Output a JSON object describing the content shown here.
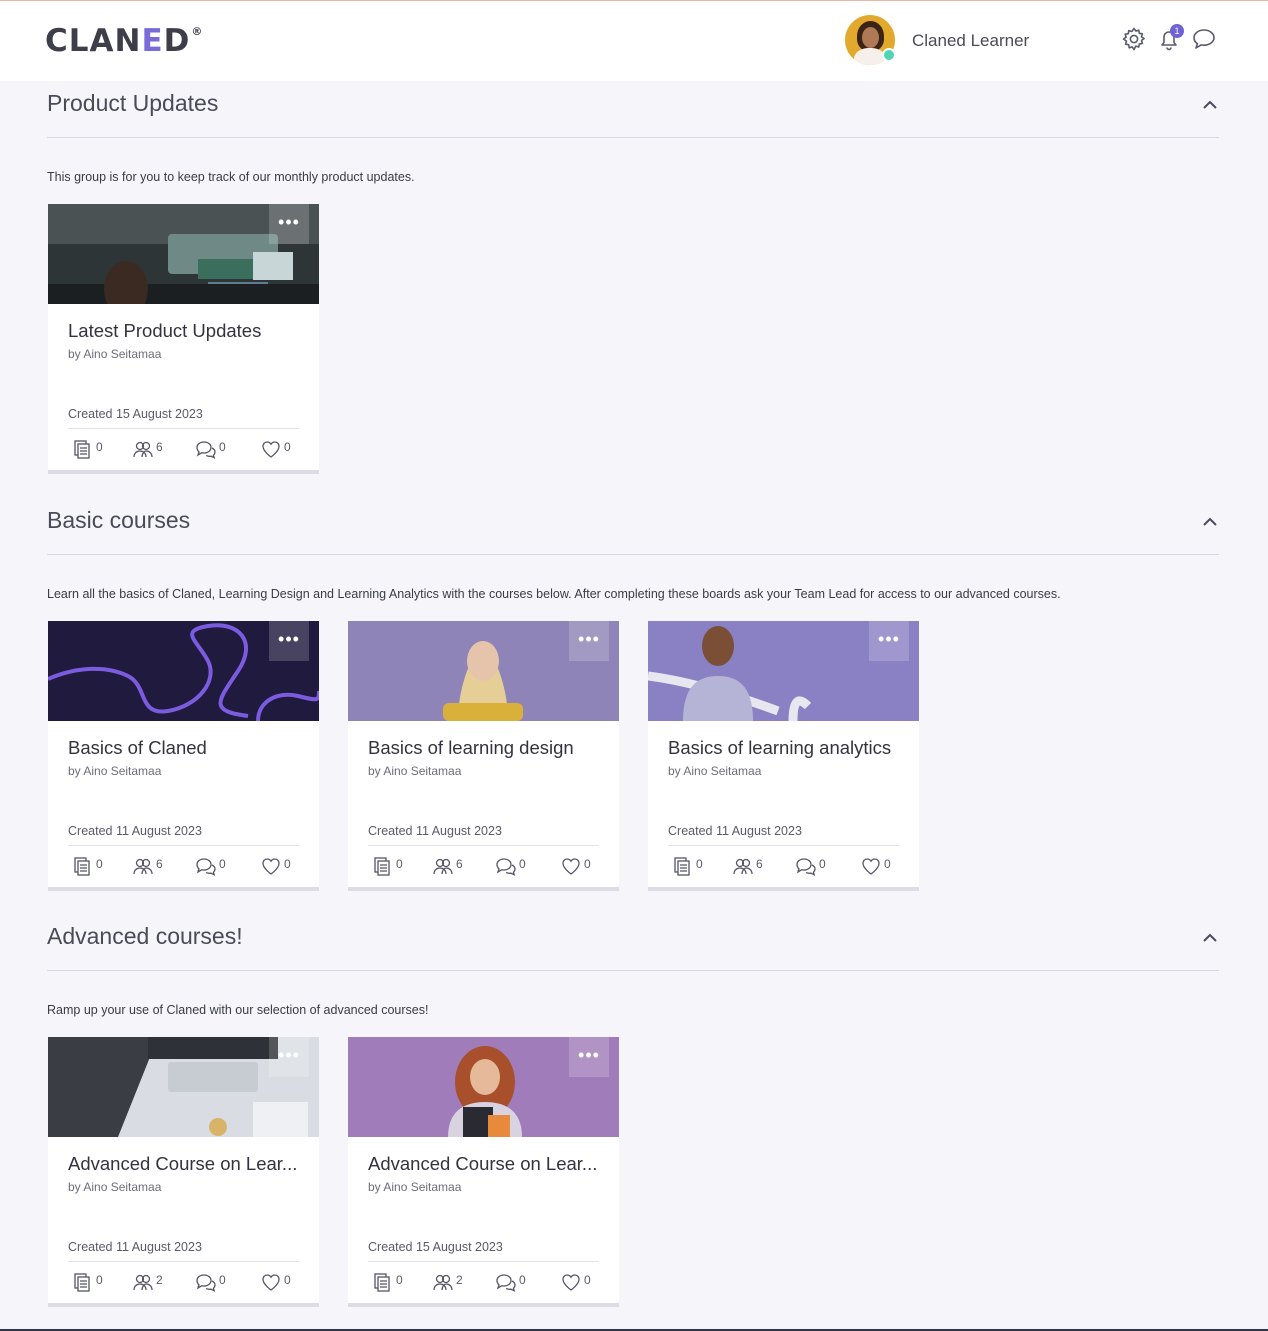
{
  "header": {
    "logo_text": "CLAN",
    "logo_e": "E",
    "logo_d": "D",
    "logo_reg": "®",
    "user_name": "Claned Learner",
    "notification_count": "1",
    "icons": [
      "gear-icon",
      "bell-icon",
      "chat-icon"
    ]
  },
  "sections": [
    {
      "title": "Product Updates",
      "description": "This group is for you to keep track of our monthly product updates.",
      "cards": [
        {
          "title": "Latest Product Updates",
          "author": "by Aino Seitamaa",
          "created": "Created 15 August 2023",
          "files": "0",
          "members": "6",
          "comments": "0",
          "likes": "0",
          "more": "•••"
        }
      ]
    },
    {
      "title": "Basic courses",
      "description": "Learn all the basics of Claned, Learning Design and Learning Analytics with the courses below. After completing these boards ask your Team Lead for access to our advanced courses.",
      "cards": [
        {
          "title": "Basics of Claned",
          "author": "by Aino Seitamaa",
          "created": "Created 11 August 2023",
          "files": "0",
          "members": "6",
          "comments": "0",
          "likes": "0",
          "more": "•••"
        },
        {
          "title": "Basics of learning design",
          "author": "by Aino Seitamaa",
          "created": "Created 11 August 2023",
          "files": "0",
          "members": "6",
          "comments": "0",
          "likes": "0",
          "more": "•••"
        },
        {
          "title": "Basics of learning analytics",
          "author": "by Aino Seitamaa",
          "created": "Created 11 August 2023",
          "files": "0",
          "members": "6",
          "comments": "0",
          "likes": "0",
          "more": "•••"
        }
      ]
    },
    {
      "title": "Advanced courses!",
      "description": "Ramp up your use of Claned with our selection of advanced courses!",
      "cards": [
        {
          "title": "Advanced Course on Lear...",
          "author": "by Aino Seitamaa",
          "created": "Created 11 August 2023",
          "files": "0",
          "members": "2",
          "comments": "0",
          "likes": "0",
          "more": "•••"
        },
        {
          "title": "Advanced Course on Lear...",
          "author": "by Aino Seitamaa",
          "created": "Created 15 August 2023",
          "files": "0",
          "members": "2",
          "comments": "0",
          "likes": "0",
          "more": "•••"
        }
      ]
    }
  ],
  "colors": {
    "accent": "#7a6cd8",
    "background": "#f6f6fa",
    "online": "#4fd5b4"
  }
}
